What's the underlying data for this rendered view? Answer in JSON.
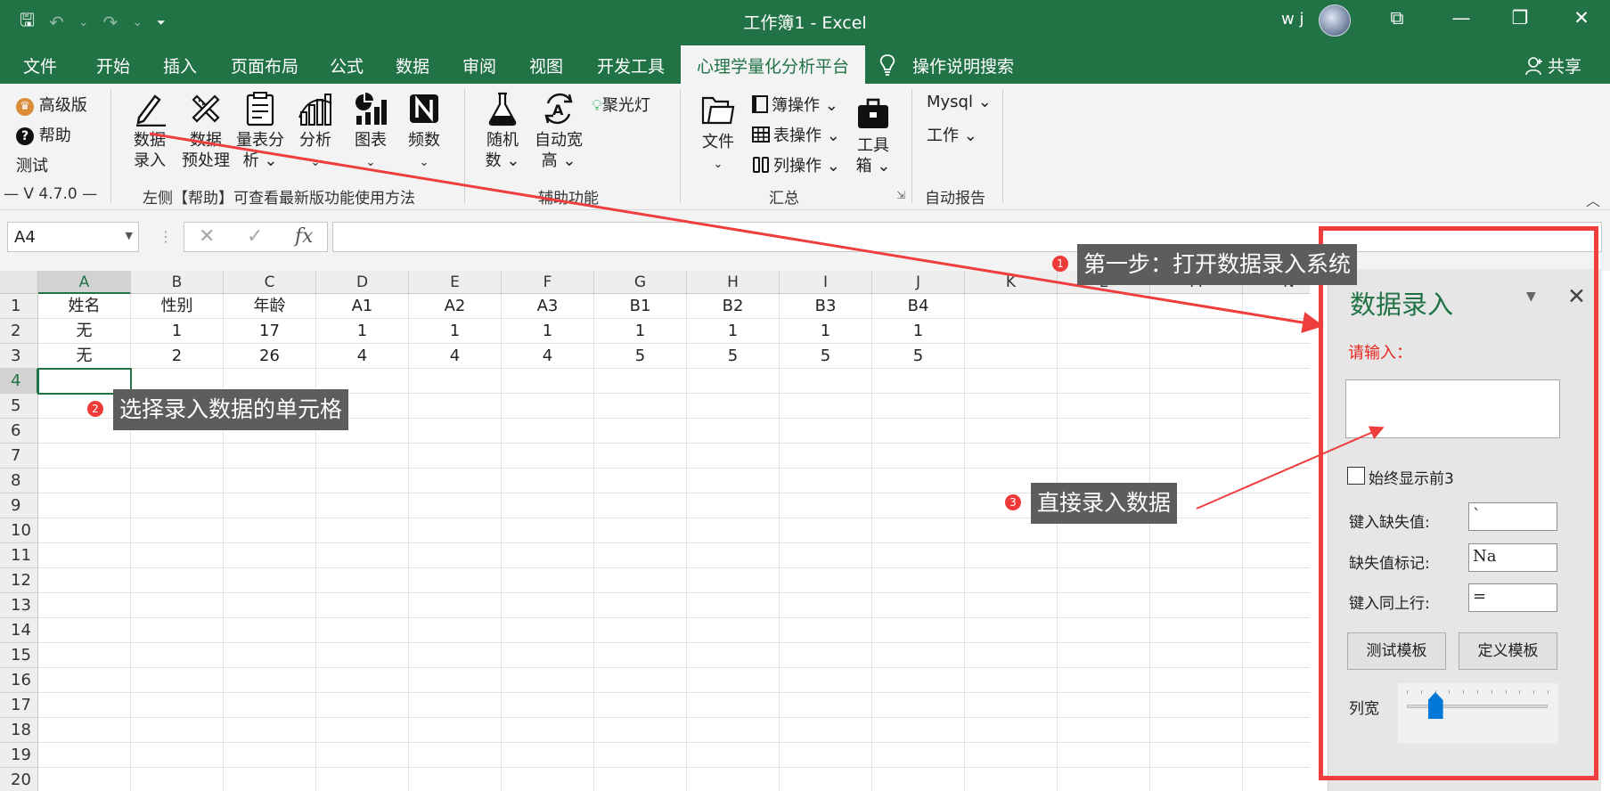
{
  "window": {
    "title": "工作簿1  -  Excel",
    "user": "w j",
    "controls": {
      "restore_ribbon": "⧉",
      "minimize": "—",
      "maximize": "❐",
      "close": "✕"
    }
  },
  "qat": {
    "save": "🖫",
    "undo": "↶",
    "undo_dd": "⌄",
    "redo": "↷",
    "redo_dd": "⌄",
    "customize": "⏷"
  },
  "tabs": [
    "文件",
    "开始",
    "插入",
    "页面布局",
    "公式",
    "数据",
    "审阅",
    "视图",
    "开发工具",
    "心理学量化分析平台",
    "操作说明搜索"
  ],
  "share": "共享",
  "ribbon": {
    "group1": {
      "premium": "高级版",
      "help": "帮助",
      "test": "测试",
      "version": "—  V 4.7.0  —"
    },
    "group2": {
      "buttons": [
        {
          "line1": "数据",
          "line2": "录入"
        },
        {
          "line1": "数据",
          "line2": "预处理"
        },
        {
          "line1": "量表分",
          "line2": "析 ⌄"
        },
        {
          "line1": "分析",
          "line2": "⌄"
        },
        {
          "line1": "图表",
          "line2": "⌄"
        },
        {
          "line1": "频数",
          "line2": "⌄"
        }
      ],
      "label": "左侧【帮助】可查看最新版功能使用方法"
    },
    "group3": {
      "buttons": [
        {
          "line1": "随机",
          "line2": "数 ⌄"
        },
        {
          "line1": "自动宽",
          "line2": "高 ⌄"
        }
      ],
      "spotlight": "聚光灯",
      "label": "辅助功能"
    },
    "group4": {
      "file": {
        "line1": "文件",
        "line2": "⌄"
      },
      "book_ops": "簿操作 ⌄",
      "sheet_ops": "表操作 ⌄",
      "col_ops": "列操作 ⌄",
      "toolbox": {
        "line1": "工具",
        "line2": "箱 ⌄"
      },
      "label": "汇总"
    },
    "group5": {
      "mysql": "Mysql ⌄",
      "work": "工作 ⌄",
      "label": "自动报告"
    }
  },
  "formula_bar": {
    "name_box": "A4",
    "cancel": "✕",
    "enter": "✓",
    "fx": "fx",
    "value": ""
  },
  "sheet": {
    "columns": [
      "A",
      "B",
      "C",
      "D",
      "E",
      "F",
      "G",
      "H",
      "I",
      "J",
      "K",
      "L",
      "M",
      "N"
    ],
    "rows": [
      "1",
      "2",
      "3",
      "4",
      "5",
      "6",
      "7",
      "8",
      "9",
      "10",
      "11",
      "12",
      "13",
      "14",
      "15",
      "16",
      "17",
      "18",
      "19",
      "20"
    ],
    "data": [
      [
        "姓名",
        "性别",
        "年龄",
        "A1",
        "A2",
        "A3",
        "B1",
        "B2",
        "B3",
        "B4"
      ],
      [
        "无",
        "1",
        "17",
        "1",
        "1",
        "1",
        "1",
        "1",
        "1",
        "1"
      ],
      [
        "无",
        "2",
        "26",
        "4",
        "4",
        "4",
        "5",
        "5",
        "5",
        "5"
      ]
    ],
    "selected_cell": "A4"
  },
  "pane": {
    "title": "数据录入",
    "prompt": "请输入：",
    "always_show": "始终显示前3",
    "fields": [
      {
        "label": "键入缺失值:",
        "value": "`"
      },
      {
        "label": "缺失值标记:",
        "value": "Na"
      },
      {
        "label": "键入同上行:",
        "value": "="
      }
    ],
    "test_template": "测试模板",
    "define_template": "定义模板",
    "col_width_label": "列宽",
    "col_width_level": 0.2
  },
  "annotations": [
    {
      "num": "1",
      "text": "第一步：打开数据录入系统"
    },
    {
      "num": "2",
      "text": "选择录入数据的单元格"
    },
    {
      "num": "3",
      "text": "直接录入数据"
    }
  ],
  "colors": {
    "excel_green": "#217346",
    "annotation_red": "#ef3e3e",
    "annotation_bg": "#5d5d5d"
  }
}
